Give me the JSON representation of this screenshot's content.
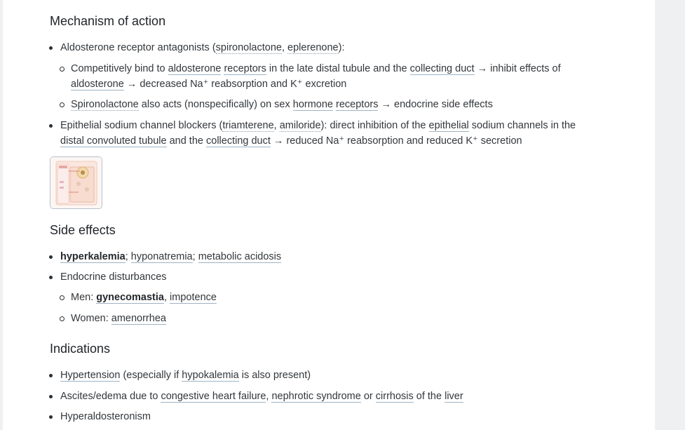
{
  "moa": {
    "heading": "Mechanism of action",
    "b1": {
      "t1": "Aldosterone receptor antagonists (",
      "l1": "spironolactone",
      "t2": ", ",
      "l2": "eplerenone",
      "t3": "):"
    },
    "s1": {
      "t1": "Competitively bind to ",
      "l1": "aldosterone",
      "t2": " ",
      "l2": "receptors",
      "t3": " in the late distal tubule and the ",
      "l3": "collecting duct",
      "t4": " → inhibit effects of",
      "l4": "aldosterone",
      "t5": " → decreased Na⁺ reabsorption and K⁺ excretion"
    },
    "s2": {
      "l1": "Spironolactone",
      "t1": " also acts (nonspecifically) on sex ",
      "l2": "hormone",
      "t2": " ",
      "l3": "receptors",
      "t3": " → endocrine side effects"
    },
    "b2": {
      "t1": "Epithelial sodium channel blockers (",
      "l1": "triamterene",
      "t2": ", ",
      "l2": "amiloride",
      "t3": "): direct inhibition of the ",
      "l3": "epithelial",
      "t4": " sodium channels in the",
      "l4": "distal convoluted tubule",
      "t5": " and the ",
      "l5": "collecting duct",
      "t6": " → reduced Na⁺ reabsorption and reduced K⁺ secretion"
    }
  },
  "side": {
    "heading": "Side effects",
    "b1": {
      "l1": "hyperkalemia",
      "t1": "; ",
      "l2": "hyponatremia",
      "t2": "; ",
      "l3": "metabolic acidosis"
    },
    "b2": {
      "t1": "Endocrine disturbances"
    },
    "s1": {
      "t1": "Men: ",
      "l1": "gynecomastia",
      "t2": ", ",
      "l2": "impotence"
    },
    "s2": {
      "t1": "Women: ",
      "l1": "amenorrhea"
    }
  },
  "ind": {
    "heading": "Indications",
    "b1": {
      "l1": "Hypertension",
      "t1": " (especially if ",
      "l2": "hypokalemia",
      "t2": " is also present)"
    },
    "b2": {
      "t1": "Ascites/edema due to ",
      "l1": "congestive heart failure",
      "t2": ", ",
      "l2": "nephrotic syndrome",
      "t3": " or ",
      "l3": "cirrhosis",
      "t4": " of the ",
      "l4": "liver"
    },
    "b3": {
      "t1": "Hyperaldosteronism"
    }
  }
}
